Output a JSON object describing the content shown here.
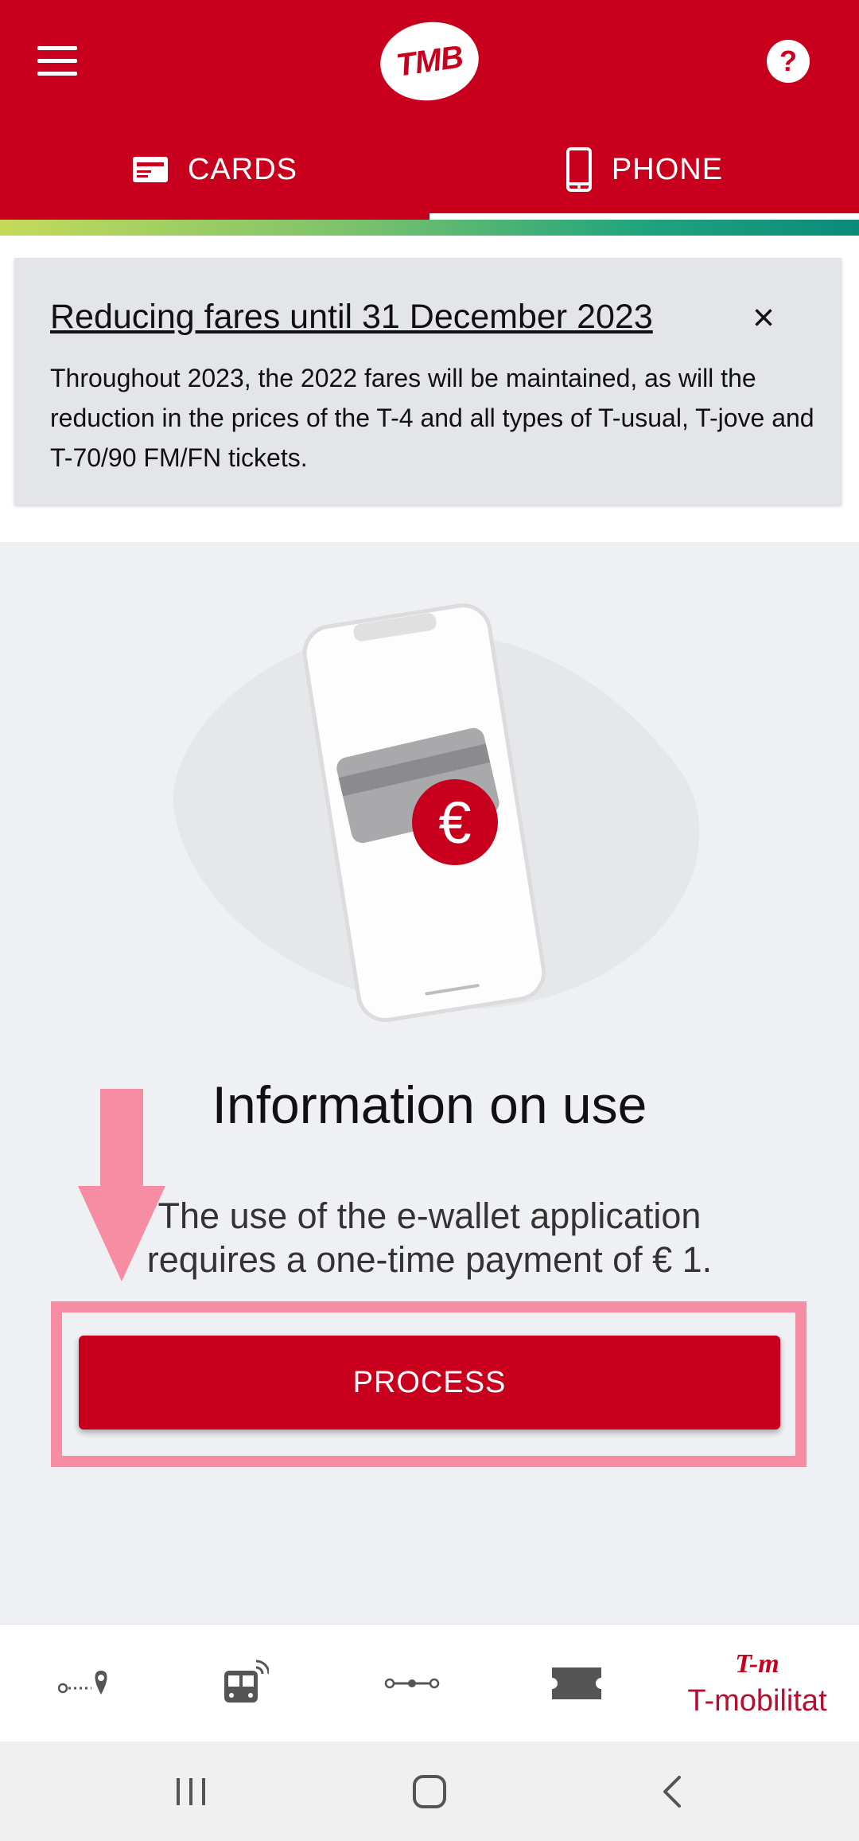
{
  "header": {
    "logo_text": "TMB",
    "help_label": "?"
  },
  "tabs": [
    {
      "label": "CARDS",
      "icon": "card-icon",
      "active": false
    },
    {
      "label": "PHONE",
      "icon": "phone-icon",
      "active": true
    }
  ],
  "notice": {
    "title": "Reducing fares until 31 December 2023",
    "close_icon": "×",
    "body": "Throughout 2023, the 2022 fares will be maintained, as will the reduction in the prices of the T-4 and all types of T-usual, T-jove and T-70/90 FM/FN tickets."
  },
  "illustration": {
    "euro_symbol": "€"
  },
  "info": {
    "title": "Information on use",
    "text": "The use of the e-wallet application requires a one-time payment of € 1."
  },
  "process_button": {
    "label": "PROCESS"
  },
  "bottom_nav": {
    "items": [
      {
        "icon": "route-planner-icon"
      },
      {
        "icon": "bus-realtime-icon"
      },
      {
        "icon": "metro-line-icon"
      },
      {
        "icon": "ticket-icon"
      },
      {
        "icon": "t-mobilitat-icon",
        "logo_text": "T-m",
        "label": "T-mobilitat",
        "active": true
      }
    ]
  },
  "colors": {
    "brand_red": "#c8001e",
    "highlight_pink": "#f78da3",
    "background": "#eff0f4"
  }
}
